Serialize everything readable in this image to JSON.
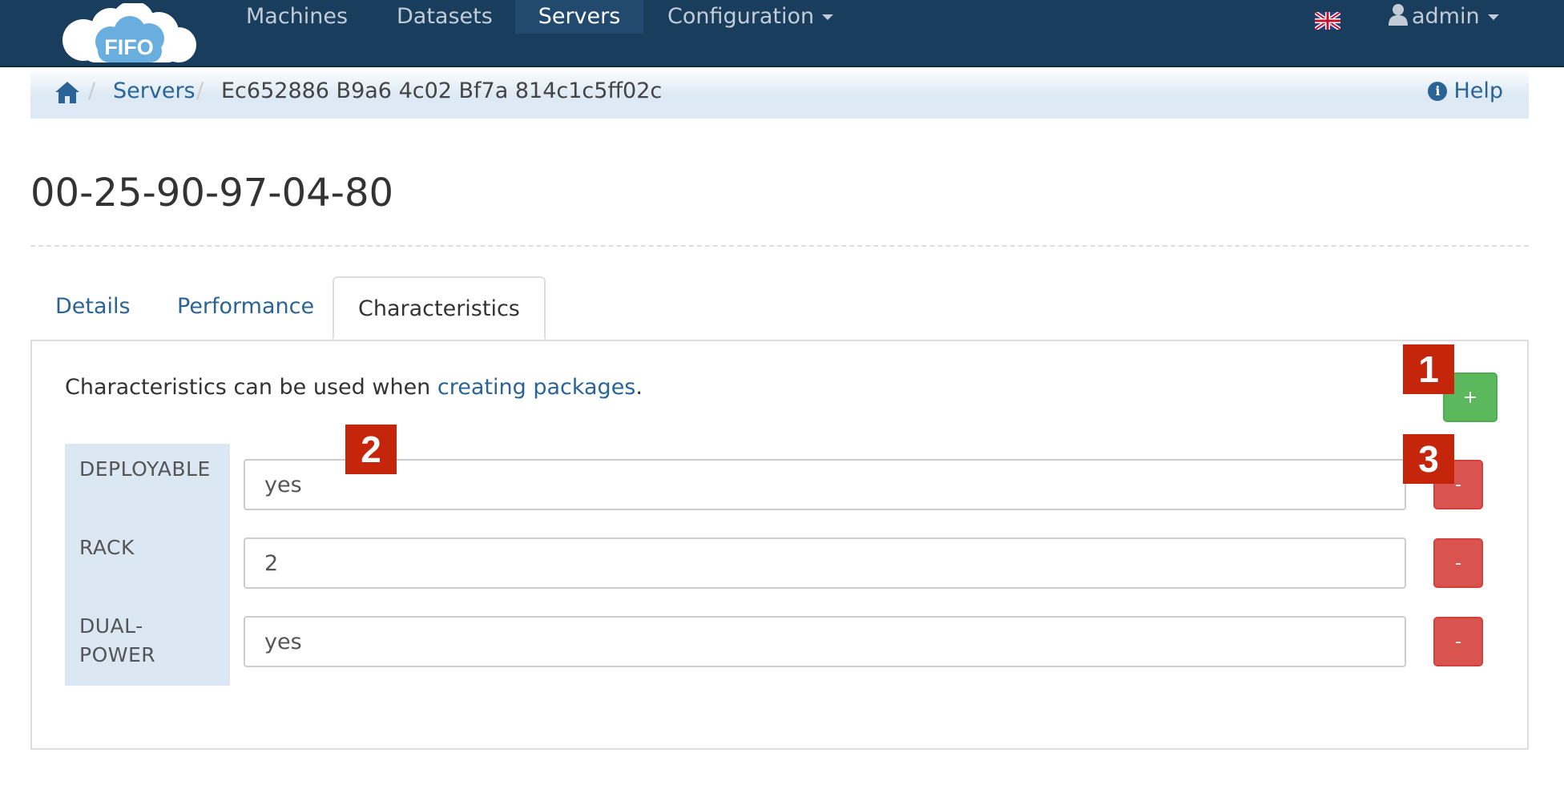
{
  "navbar": {
    "logo_text": "FIFO",
    "items": [
      {
        "label": "Machines"
      },
      {
        "label": "Datasets"
      },
      {
        "label": "Servers",
        "active": true
      },
      {
        "label": "Configuration"
      }
    ],
    "language_flag": "uk-flag-icon",
    "user_label": "admin"
  },
  "breadcrumb": {
    "servers_label": "Servers",
    "current": "Ec652886 B9a6 4c02 Bf7a 814c1c5ff02c",
    "help_label": "Help"
  },
  "page": {
    "title": "00-25-90-97-04-80"
  },
  "tabs": [
    {
      "label": "Details"
    },
    {
      "label": "Performance"
    },
    {
      "label": "Characteristics",
      "active": true
    }
  ],
  "characteristics": {
    "intro_text": "Characteristics can be used when ",
    "intro_link": "creating packages",
    "intro_suffix": ".",
    "add_label": "+",
    "remove_label": "-",
    "rows": [
      {
        "key": "DEPLOYABLE",
        "value": "yes"
      },
      {
        "key": "RACK",
        "value": "2"
      },
      {
        "key": "DUAL-POWER",
        "value": "yes"
      }
    ]
  },
  "markers": [
    "1",
    "2",
    "3"
  ],
  "colors": {
    "navbar": "#193d5c",
    "link": "#2a6496",
    "add_button": "#5cb85c",
    "remove_button": "#d9534f",
    "marker": "#c4250b",
    "label_column": "#dbe8f4"
  }
}
